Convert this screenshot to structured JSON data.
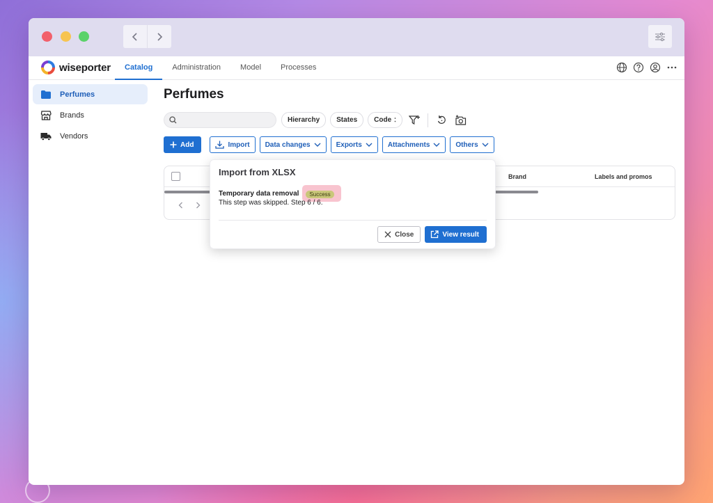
{
  "app": {
    "brand": "wiseporter"
  },
  "tabs": [
    {
      "label": "Catalog",
      "active": true
    },
    {
      "label": "Administration",
      "active": false
    },
    {
      "label": "Model",
      "active": false
    },
    {
      "label": "Processes",
      "active": false
    }
  ],
  "sidebar": {
    "items": [
      {
        "label": "Perfumes",
        "icon": "folder-icon",
        "active": true
      },
      {
        "label": "Brands",
        "icon": "store-icon",
        "active": false
      },
      {
        "label": "Vendors",
        "icon": "truck-icon",
        "active": false
      }
    ]
  },
  "main": {
    "title": "Perfumes",
    "search": {
      "placeholder": "",
      "value": ""
    },
    "chips": {
      "hierarchy": "Hierarchy",
      "states": "States",
      "code": "Code"
    },
    "actions": {
      "add": "Add",
      "import": "Import",
      "data_changes": "Data changes",
      "exports": "Exports",
      "attachments": "Attachments",
      "others": "Others"
    },
    "table": {
      "columns": {
        "brand": "Brand",
        "labels": "Labels and promos"
      }
    }
  },
  "popover": {
    "title": "Import from XLSX",
    "step_label": "Temporary data removal",
    "status": "Success",
    "message": "This step was skipped. Step 6 / 6.",
    "close": "Close",
    "view_result": "View result"
  },
  "colors": {
    "accent": "#1f6fd1",
    "badge_bg": "#c9c77a",
    "badge_highlight": "#f8c4cf"
  }
}
